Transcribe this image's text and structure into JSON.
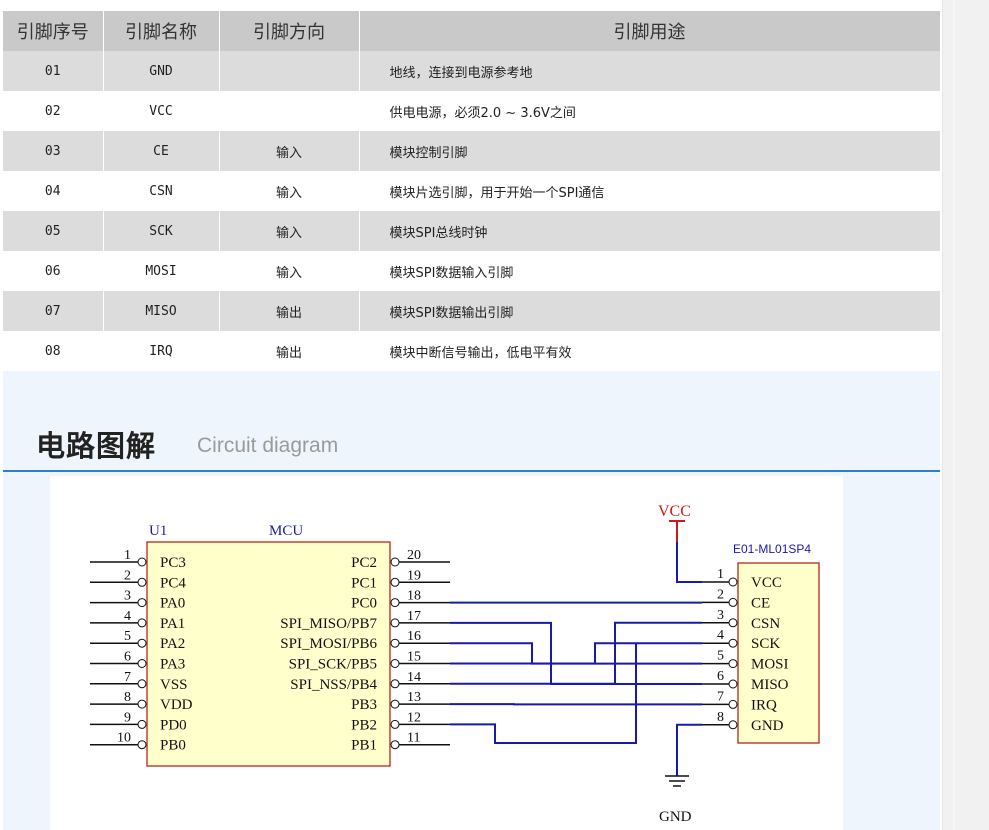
{
  "table": {
    "headers": [
      "引脚序号",
      "引脚名称",
      "引脚方向",
      "引脚用途"
    ],
    "rows": [
      {
        "no": "01",
        "name": "GND",
        "dir": "",
        "desc": "地线，连接到电源参考地"
      },
      {
        "no": "02",
        "name": "VCC",
        "dir": "",
        "desc": "供电电源，必须2.0 ~ 3.6V之间"
      },
      {
        "no": "03",
        "name": "CE",
        "dir": "输入",
        "desc": "模块控制引脚"
      },
      {
        "no": "04",
        "name": "CSN",
        "dir": "输入",
        "desc": "模块片选引脚，用于开始一个SPI通信"
      },
      {
        "no": "05",
        "name": "SCK",
        "dir": "输入",
        "desc": "模块SPI总线时钟"
      },
      {
        "no": "06",
        "name": "MOSI",
        "dir": "输入",
        "desc": "模块SPI数据输入引脚"
      },
      {
        "no": "07",
        "name": "MISO",
        "dir": "输出",
        "desc": "模块SPI数据输出引脚"
      },
      {
        "no": "08",
        "name": "IRQ",
        "dir": "输出",
        "desc": "模块中断信号输出，低电平有效"
      }
    ]
  },
  "section": {
    "title": "电路图解",
    "subtitle": "Circuit diagram"
  },
  "diagram": {
    "mcu_ref": "U1",
    "mcu_name": "MCU",
    "mcu_left_pins": [
      {
        "num": "1",
        "label": "PC3"
      },
      {
        "num": "2",
        "label": "PC4"
      },
      {
        "num": "3",
        "label": "PA0"
      },
      {
        "num": "4",
        "label": "PA1"
      },
      {
        "num": "5",
        "label": "PA2"
      },
      {
        "num": "6",
        "label": "PA3"
      },
      {
        "num": "7",
        "label": "VSS"
      },
      {
        "num": "8",
        "label": "VDD"
      },
      {
        "num": "9",
        "label": "PD0"
      },
      {
        "num": "10",
        "label": "PB0"
      }
    ],
    "mcu_right_pins": [
      {
        "num": "20",
        "label": "PC2"
      },
      {
        "num": "19",
        "label": "PC1"
      },
      {
        "num": "18",
        "label": "PC0"
      },
      {
        "num": "17",
        "label": "SPI_MISO/PB7"
      },
      {
        "num": "16",
        "label": "SPI_MOSI/PB6"
      },
      {
        "num": "15",
        "label": "SPI_SCK/PB5"
      },
      {
        "num": "14",
        "label": "SPI_NSS/PB4"
      },
      {
        "num": "13",
        "label": "PB3"
      },
      {
        "num": "12",
        "label": "PB2"
      },
      {
        "num": "11",
        "label": "PB1"
      }
    ],
    "module_name": "E01-ML01SP4",
    "module_pins": [
      {
        "num": "1",
        "label": "VCC"
      },
      {
        "num": "2",
        "label": "CE"
      },
      {
        "num": "3",
        "label": "CSN"
      },
      {
        "num": "4",
        "label": "SCK"
      },
      {
        "num": "5",
        "label": "MOSI"
      },
      {
        "num": "6",
        "label": "MISO"
      },
      {
        "num": "7",
        "label": "IRQ"
      },
      {
        "num": "8",
        "label": "GND"
      }
    ],
    "vcc_label": "VCC",
    "gnd_label": "GND",
    "colors": {
      "wire": "#1a1aa8",
      "ic_fill": "#ffffcc",
      "ic_border": "#b3261e",
      "vcc": "#cc1a1a"
    }
  }
}
